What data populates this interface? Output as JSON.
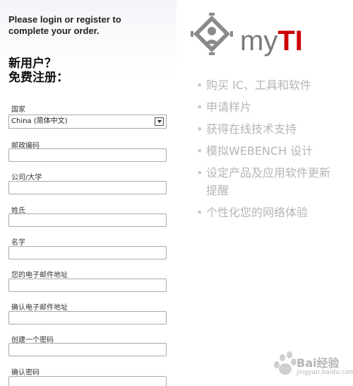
{
  "intro": {
    "line1": "Please login or register to",
    "line2": "complete your order."
  },
  "heading": {
    "line1": "新用户？",
    "line2": "免费注册："
  },
  "form": {
    "country_label": "国家",
    "country_value": "China (简体中文)",
    "postal_label": "邮政编码",
    "company_label": "公司/大学",
    "lastname_label": "姓氏",
    "firstname_label": "名字",
    "email_label": "您的电子邮件地址",
    "email_confirm_label": "确认电子邮件地址",
    "password_label": "创建一个密码",
    "password_confirm_label": "确认密码"
  },
  "logo": {
    "my": "my",
    "ti": "TI",
    "colors": {
      "red": "#cc0000",
      "gray": "#7a7a7a"
    }
  },
  "features": [
    "购买 IC、工具和软件",
    "申请样片",
    "获得在线技术支持",
    "模拟WEBENCH 设计",
    "设定产品及应用软件更新提醒",
    "个性化您的网络体验"
  ],
  "watermark": {
    "text": "Bai经验",
    "sub": "jingyan.baidu.com"
  }
}
